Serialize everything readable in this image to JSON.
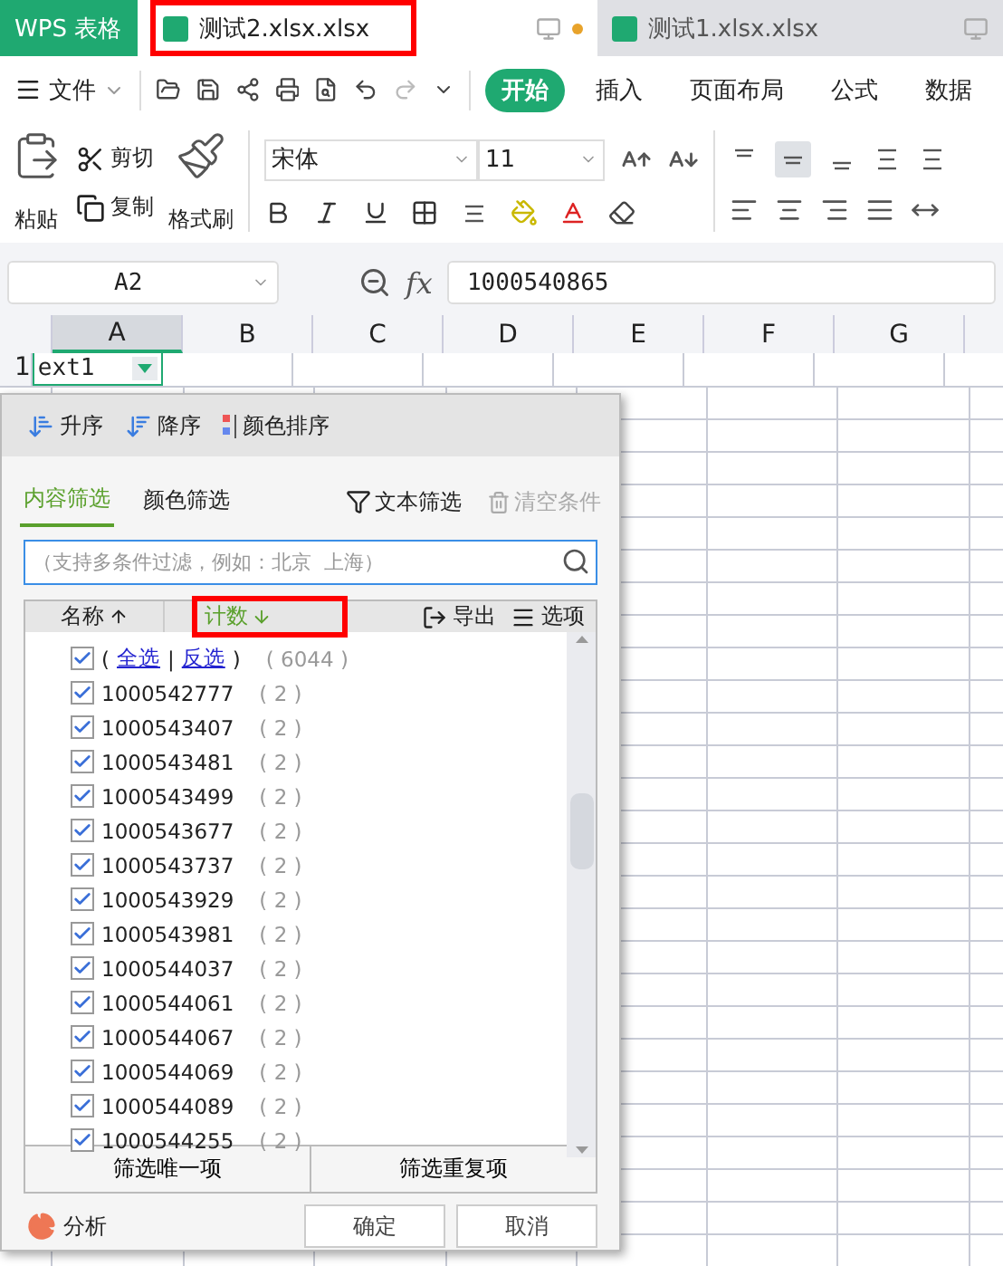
{
  "app_button": {
    "label": "WPS 表格"
  },
  "tabs": [
    {
      "label": "测试2.xlsx.xlsx",
      "selected": true,
      "highlighted": true,
      "unsaved": true
    },
    {
      "label": "测试1.xlsx.xlsx",
      "selected": false,
      "highlighted": false,
      "unsaved": false
    }
  ],
  "menu": {
    "file": "文件",
    "tabs": [
      {
        "label": "开始",
        "selected": true
      },
      {
        "label": "插入",
        "selected": false
      },
      {
        "label": "页面布局",
        "selected": false
      },
      {
        "label": "公式",
        "selected": false
      },
      {
        "label": "数据",
        "selected": false
      }
    ]
  },
  "ribbon": {
    "paste": "粘贴",
    "cut": "剪切",
    "copy": "复制",
    "format_painter": "格式刷",
    "font": "宋体",
    "size": "11"
  },
  "formula_bar": {
    "cell": "A2",
    "fx": "fx",
    "value": "1000540865"
  },
  "columns": [
    {
      "label": "A",
      "selected": true
    },
    {
      "label": "B",
      "selected": false
    },
    {
      "label": "C",
      "selected": false
    },
    {
      "label": "D",
      "selected": false
    },
    {
      "label": "E",
      "selected": false
    },
    {
      "label": "F",
      "selected": false
    },
    {
      "label": "G",
      "selected": false
    }
  ],
  "rows": [
    {
      "number": "1",
      "cells": [
        "ext1"
      ]
    }
  ],
  "filter": {
    "sort": [
      "升序",
      "降序",
      "颜色排序"
    ],
    "tabs": [
      {
        "label": "内容筛选",
        "selected": true
      },
      {
        "label": "颜色筛选",
        "selected": false
      }
    ],
    "text_filter": "文本筛选",
    "clear": "清空条件",
    "clear_disabled": true,
    "search_placeholder": "（支持多条件过滤，例如：北京  上海）",
    "header": {
      "name": "名称",
      "count": "计数",
      "count_highlighted": true,
      "export": "导出",
      "options": "选项"
    },
    "select_all": {
      "open": "(",
      "all": "全选",
      "separator": "|",
      "invert": "反选",
      "close": ")",
      "count": "( 6044 )",
      "checked": true
    },
    "items": [
      {
        "value": "1000542777",
        "count": "( 2 )",
        "checked": true
      },
      {
        "value": "1000543407",
        "count": "( 2 )",
        "checked": true
      },
      {
        "value": "1000543481",
        "count": "( 2 )",
        "checked": true
      },
      {
        "value": "1000543499",
        "count": "( 2 )",
        "checked": true
      },
      {
        "value": "1000543677",
        "count": "( 2 )",
        "checked": true
      },
      {
        "value": "1000543737",
        "count": "( 2 )",
        "checked": true
      },
      {
        "value": "1000543929",
        "count": "( 2 )",
        "checked": true
      },
      {
        "value": "1000543981",
        "count": "( 2 )",
        "checked": true
      },
      {
        "value": "1000544037",
        "count": "( 2 )",
        "checked": true
      },
      {
        "value": "1000544061",
        "count": "( 2 )",
        "checked": true
      },
      {
        "value": "1000544067",
        "count": "( 2 )",
        "checked": true
      },
      {
        "value": "1000544069",
        "count": "( 2 )",
        "checked": true
      },
      {
        "value": "1000544089",
        "count": "( 2 )",
        "checked": true
      },
      {
        "value": "1000544255",
        "count": "( 2 )",
        "checked": true
      }
    ],
    "unique": "筛选唯一项",
    "duplicate": "筛选重复项",
    "analysis": "分析",
    "ok": "确定",
    "cancel": "取消"
  }
}
